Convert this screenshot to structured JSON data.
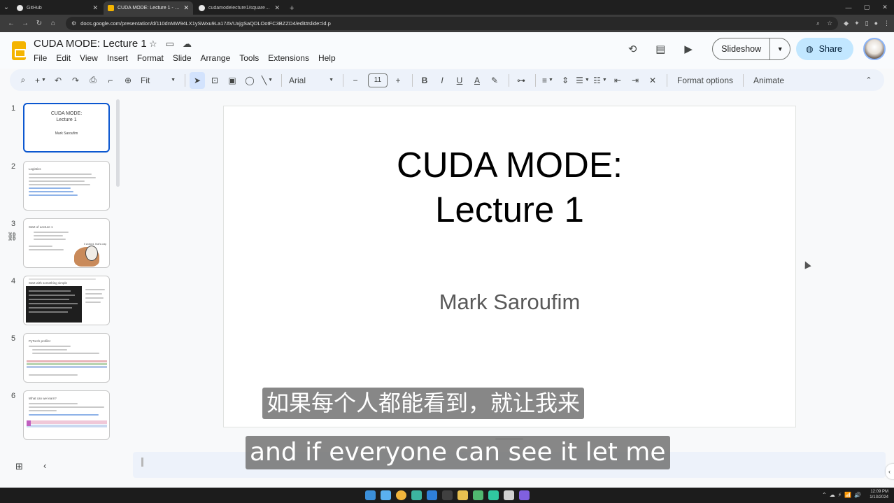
{
  "browser": {
    "tabs": [
      {
        "label": "GitHub",
        "active": false,
        "icon": "github-icon"
      },
      {
        "label": "CUDA MODE: Lecture 1 - Google",
        "active": true,
        "icon": "slides-icon"
      },
      {
        "label": "cudamodelecture1/square_kernel",
        "active": false,
        "icon": "github-icon"
      }
    ],
    "url": "docs.google.com/presentation/d/110dnMW94LX1ySWxu9La17AVUxjgSaQDLOotFC3BZZD4/edit#slide=id.p"
  },
  "doc": {
    "title": "CUDA MODE: Lecture 1",
    "menu": [
      "File",
      "Edit",
      "View",
      "Insert",
      "Format",
      "Slide",
      "Arrange",
      "Tools",
      "Extensions",
      "Help"
    ],
    "slideshow_label": "Slideshow",
    "share_label": "Share"
  },
  "toolbar": {
    "zoom": "Fit",
    "font": "Arial",
    "font_size": "11",
    "format_options": "Format options",
    "animate": "Animate"
  },
  "filmstrip": {
    "slides": [
      {
        "num": "1",
        "title": "CUDA MODE:\nLecture 1",
        "sub": "Mark Saroufim"
      },
      {
        "num": "2",
        "heading": "Logistics"
      },
      {
        "num": "3",
        "heading": "Start of Lecture 1",
        "caption": "It worked, that's crap"
      },
      {
        "num": "4",
        "heading": "Start with something simple"
      },
      {
        "num": "5",
        "heading": "PyTorch profiler"
      },
      {
        "num": "6",
        "heading": "What can we learn?"
      }
    ]
  },
  "slide": {
    "title_line1": "CUDA MODE:",
    "title_line2": "Lecture 1",
    "subtitle": "Mark Saroufim"
  },
  "subtitles": {
    "chinese": "如果每个人都能看到，就让我来",
    "english": "and if everyone can see it let me"
  },
  "taskbar": {
    "time": "12:09 PM",
    "date": "1/13/2024"
  }
}
